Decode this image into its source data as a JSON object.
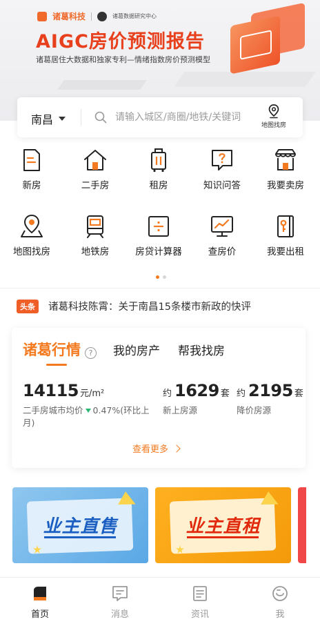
{
  "banner": {
    "brand": "诸葛科技",
    "partner": "诸葛数据研究中心",
    "title": "AIGC房价预测报告",
    "subtitle": "诸葛居住大数据和独家专利—情绪指数房价预测模型"
  },
  "search": {
    "city": "南昌",
    "placeholder": "请输入城区/商圈/地铁/关键词",
    "value": "",
    "map_label": "地图找房"
  },
  "grid": [
    {
      "label": "新房",
      "icon": "new-house-icon"
    },
    {
      "label": "二手房",
      "icon": "second-hand-house-icon"
    },
    {
      "label": "租房",
      "icon": "rent-suitcase-icon"
    },
    {
      "label": "知识问答",
      "icon": "qa-bubble-icon"
    },
    {
      "label": "我要卖房",
      "icon": "storefront-icon"
    },
    {
      "label": "地图找房",
      "icon": "map-pin-icon"
    },
    {
      "label": "地铁房",
      "icon": "subway-train-icon"
    },
    {
      "label": "房贷计算器",
      "icon": "calculator-icon"
    },
    {
      "label": "查房价",
      "icon": "price-chart-icon"
    },
    {
      "label": "我要出租",
      "icon": "key-door-icon"
    }
  ],
  "headline": {
    "tag": "头条",
    "text": "诸葛科技陈霄：关于南昌15条楼市新政的快评"
  },
  "market": {
    "tabs": [
      "诸葛行情",
      "我的房产",
      "帮我找房"
    ],
    "price_value": "14115",
    "price_unit": "元/m²",
    "price_desc": "二手房城市均价",
    "price_change": "0.47%(环比上月)",
    "new_pre": "约",
    "new_value": "1629",
    "new_unit": "套",
    "new_desc": "新上房源",
    "drop_pre": "约",
    "drop_value": "2195",
    "drop_unit": "套",
    "drop_desc": "降价房源",
    "more": "查看更多"
  },
  "promos": [
    {
      "label": "业主直售"
    },
    {
      "label": "业主直租"
    }
  ],
  "tabbar": [
    {
      "label": "首页",
      "icon": "home-icon"
    },
    {
      "label": "消息",
      "icon": "message-icon"
    },
    {
      "label": "资讯",
      "icon": "news-icon"
    },
    {
      "label": "我",
      "icon": "profile-icon"
    }
  ],
  "colors": {
    "accent": "#f47a20",
    "headline_tag": "#f05e28",
    "banner_title": "#e8401c",
    "price_down": "#2bb673"
  }
}
